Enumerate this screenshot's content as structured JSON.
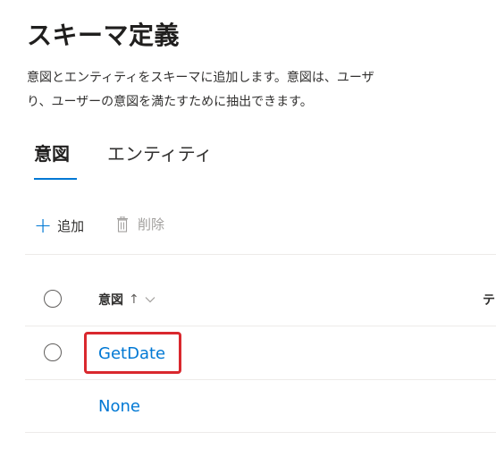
{
  "page": {
    "title": "スキーマ定義",
    "description_lines": [
      "意図とエンティティをスキーマに追加します。意図は、ユーザ",
      "り、ユーザーの意図を満たすために抽出できます。"
    ]
  },
  "tabs": [
    {
      "label": "意図",
      "selected": true
    },
    {
      "label": "エンティティ",
      "selected": false
    }
  ],
  "toolbar": {
    "add_label": "追加",
    "add_icon": "plus-icon",
    "delete_label": "削除",
    "delete_icon": "trash-icon"
  },
  "table": {
    "columns": [
      {
        "label": "意図",
        "sort_glyph": "↑",
        "menu_icon": "chevron-down-icon"
      },
      {
        "label": "テ"
      }
    ],
    "rows": [
      {
        "name": "GetDate",
        "has_selector": true,
        "highlighted": true
      },
      {
        "name": "None",
        "has_selector": false
      }
    ]
  },
  "colors": {
    "accent": "#0078d4",
    "highlight": "#d9282e",
    "text": "#323130",
    "muted": "#a19f9d"
  }
}
